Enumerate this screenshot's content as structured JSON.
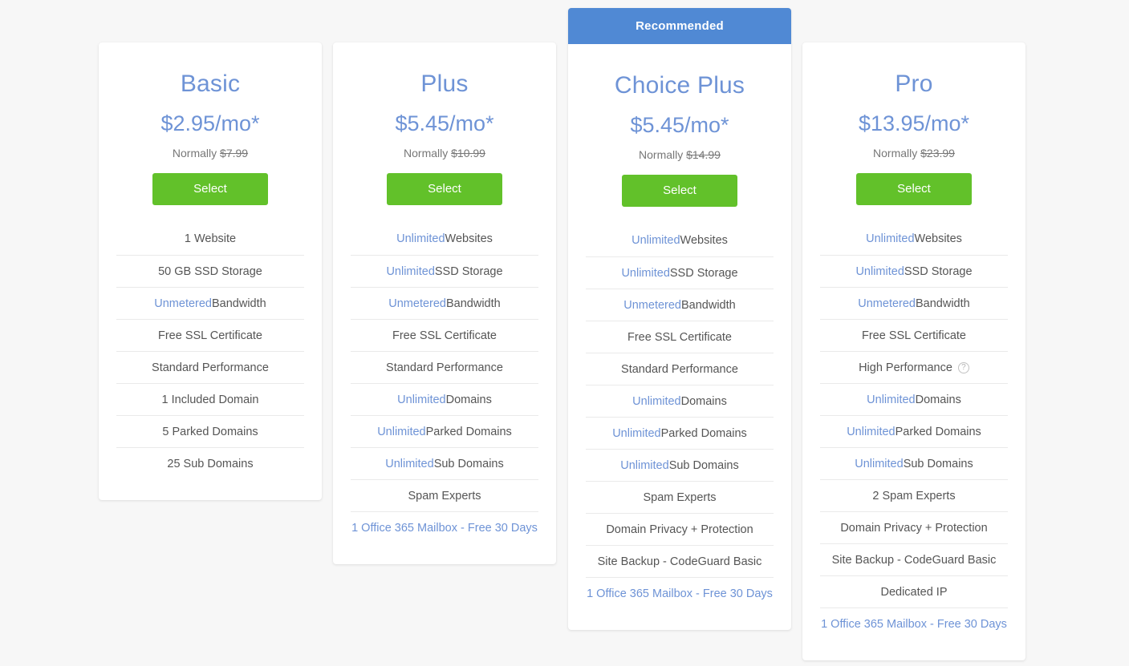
{
  "page": {
    "background_color": "#f7f7f7",
    "accent_blue": "#6e93d6",
    "banner_blue": "#5089d4",
    "button_green": "#62c12a"
  },
  "plans": [
    {
      "name": "Basic",
      "price": "$2.95/mo*",
      "normally_label": "Normally",
      "normally_price": "$7.99",
      "select_label": "Select",
      "banner": null,
      "features": [
        {
          "highlight": "",
          "text": "1 Website",
          "link": false,
          "help": false
        },
        {
          "highlight": "",
          "text": "50 GB SSD Storage",
          "link": false,
          "help": false
        },
        {
          "highlight": "Unmetered",
          "text": " Bandwidth",
          "link": false,
          "help": false
        },
        {
          "highlight": "",
          "text": "Free SSL Certificate",
          "link": false,
          "help": false
        },
        {
          "highlight": "",
          "text": "Standard Performance",
          "link": false,
          "help": false
        },
        {
          "highlight": "",
          "text": "1 Included Domain",
          "link": false,
          "help": false
        },
        {
          "highlight": "",
          "text": "5 Parked Domains",
          "link": false,
          "help": false
        },
        {
          "highlight": "",
          "text": "25 Sub Domains",
          "link": false,
          "help": false
        }
      ]
    },
    {
      "name": "Plus",
      "price": "$5.45/mo*",
      "normally_label": "Normally",
      "normally_price": "$10.99",
      "select_label": "Select",
      "banner": null,
      "features": [
        {
          "highlight": "Unlimited",
          "text": " Websites",
          "link": false,
          "help": false
        },
        {
          "highlight": "Unlimited",
          "text": " SSD Storage",
          "link": false,
          "help": false
        },
        {
          "highlight": "Unmetered",
          "text": " Bandwidth",
          "link": false,
          "help": false
        },
        {
          "highlight": "",
          "text": "Free SSL Certificate",
          "link": false,
          "help": false
        },
        {
          "highlight": "",
          "text": "Standard Performance",
          "link": false,
          "help": false
        },
        {
          "highlight": "Unlimited",
          "text": " Domains",
          "link": false,
          "help": false
        },
        {
          "highlight": "Unlimited",
          "text": " Parked Domains",
          "link": false,
          "help": false
        },
        {
          "highlight": "Unlimited",
          "text": " Sub Domains",
          "link": false,
          "help": false
        },
        {
          "highlight": "",
          "text": "Spam Experts",
          "link": false,
          "help": false
        },
        {
          "highlight": "",
          "text": "1 Office 365 Mailbox - Free 30 Days",
          "link": true,
          "help": false
        }
      ]
    },
    {
      "name": "Choice Plus",
      "price": "$5.45/mo*",
      "normally_label": "Normally",
      "normally_price": "$14.99",
      "select_label": "Select",
      "banner": "Recommended",
      "features": [
        {
          "highlight": "Unlimited",
          "text": " Websites",
          "link": false,
          "help": false
        },
        {
          "highlight": "Unlimited",
          "text": " SSD Storage",
          "link": false,
          "help": false
        },
        {
          "highlight": "Unmetered",
          "text": " Bandwidth",
          "link": false,
          "help": false
        },
        {
          "highlight": "",
          "text": "Free SSL Certificate",
          "link": false,
          "help": false
        },
        {
          "highlight": "",
          "text": "Standard Performance",
          "link": false,
          "help": false
        },
        {
          "highlight": "Unlimited",
          "text": " Domains",
          "link": false,
          "help": false
        },
        {
          "highlight": "Unlimited",
          "text": " Parked Domains",
          "link": false,
          "help": false
        },
        {
          "highlight": "Unlimited",
          "text": " Sub Domains",
          "link": false,
          "help": false
        },
        {
          "highlight": "",
          "text": "Spam Experts",
          "link": false,
          "help": false
        },
        {
          "highlight": "",
          "text": "Domain Privacy + Protection",
          "link": false,
          "help": false
        },
        {
          "highlight": "",
          "text": "Site Backup - CodeGuard Basic",
          "link": false,
          "help": false
        },
        {
          "highlight": "",
          "text": "1 Office 365 Mailbox - Free 30 Days",
          "link": true,
          "help": false
        }
      ]
    },
    {
      "name": "Pro",
      "price": "$13.95/mo*",
      "normally_label": "Normally",
      "normally_price": "$23.99",
      "select_label": "Select",
      "banner": null,
      "features": [
        {
          "highlight": "Unlimited",
          "text": " Websites",
          "link": false,
          "help": false
        },
        {
          "highlight": "Unlimited",
          "text": " SSD Storage",
          "link": false,
          "help": false
        },
        {
          "highlight": "Unmetered",
          "text": " Bandwidth",
          "link": false,
          "help": false
        },
        {
          "highlight": "",
          "text": "Free SSL Certificate",
          "link": false,
          "help": false
        },
        {
          "highlight": "",
          "text": "High Performance",
          "link": false,
          "help": true
        },
        {
          "highlight": "Unlimited",
          "text": " Domains",
          "link": false,
          "help": false
        },
        {
          "highlight": "Unlimited",
          "text": " Parked Domains",
          "link": false,
          "help": false
        },
        {
          "highlight": "Unlimited",
          "text": " Sub Domains",
          "link": false,
          "help": false
        },
        {
          "highlight": "",
          "text": "2 Spam Experts",
          "link": false,
          "help": false
        },
        {
          "highlight": "",
          "text": "Domain Privacy + Protection",
          "link": false,
          "help": false
        },
        {
          "highlight": "",
          "text": "Site Backup - CodeGuard Basic",
          "link": false,
          "help": false
        },
        {
          "highlight": "",
          "text": "Dedicated IP",
          "link": false,
          "help": false
        },
        {
          "highlight": "",
          "text": "1 Office 365 Mailbox - Free 30 Days",
          "link": true,
          "help": false
        }
      ]
    }
  ],
  "icons": {
    "help": "?"
  }
}
